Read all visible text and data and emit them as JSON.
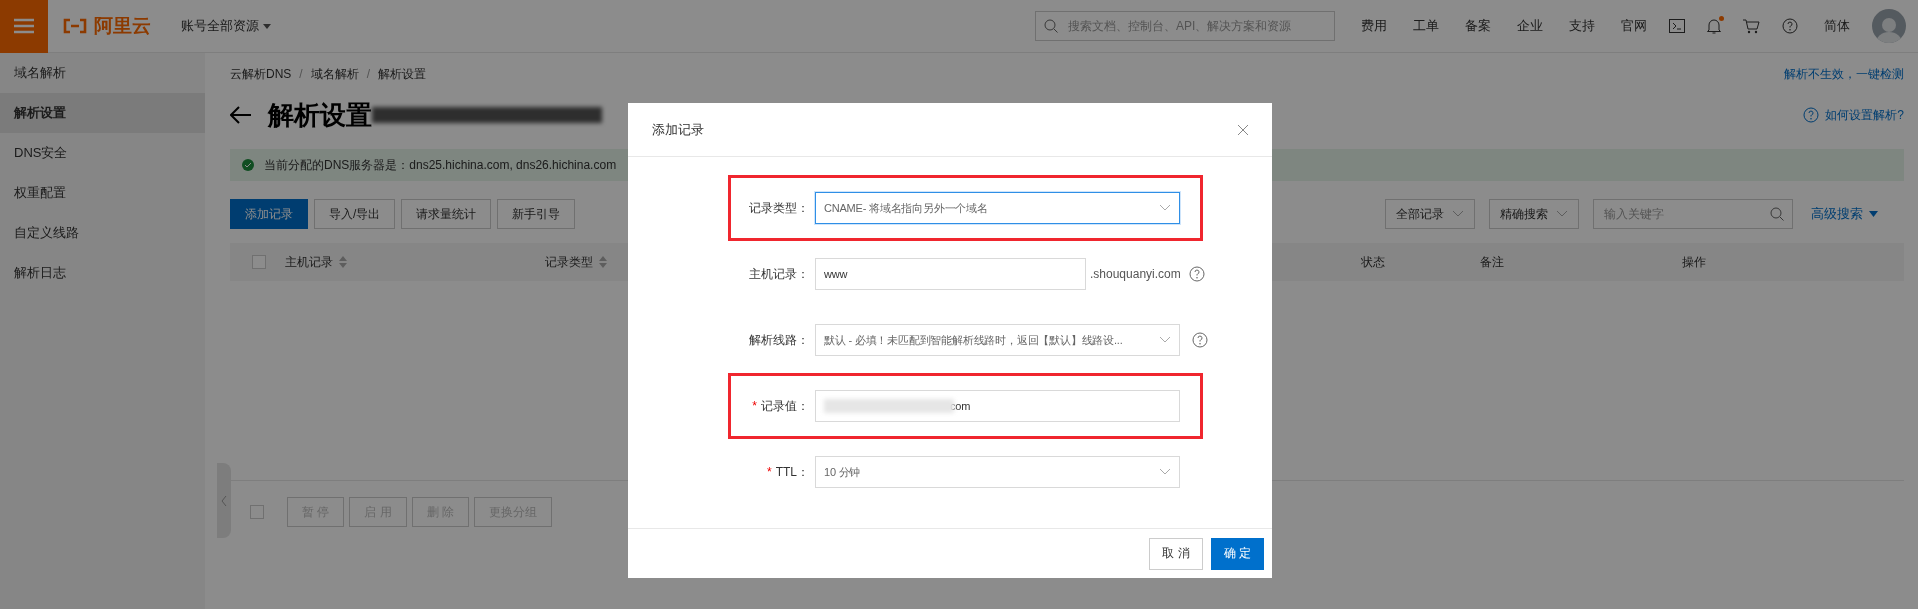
{
  "topbar": {
    "logo": "阿里云",
    "account_menu": "账号全部资源",
    "search": {
      "placeholder": "搜索文档、控制台、API、解决方案和资源"
    },
    "nav_links": [
      "费用",
      "工单",
      "备案",
      "企业",
      "支持",
      "官网"
    ],
    "bell_dot": true,
    "language": "简体"
  },
  "sidebar": {
    "title": "域名解析",
    "items": [
      {
        "label": "解析设置",
        "selected": true
      },
      {
        "label": "DNS安全",
        "selected": false
      },
      {
        "label": "权重配置",
        "selected": false
      },
      {
        "label": "自定义线路",
        "selected": false
      },
      {
        "label": "解析日志",
        "selected": false
      }
    ]
  },
  "breadcrumb": [
    "云解析DNS",
    "域名解析",
    "解析设置"
  ],
  "breadcrumb_separator": "/",
  "header_checkbox": {
    "checked": false
  },
  "bulk_checkbox": {
    "checked": false
  },
  "check_link": "解析不生效，一键检测",
  "page_title": "解析设置",
  "help_link": "如何设置解析?",
  "alert": "当前分配的DNS服务器是：dns25.hichina.com, dns26.hichina.com",
  "actions": [
    {
      "label": "添加记录",
      "primary": true
    },
    {
      "label": "导入/导出",
      "primary": false
    },
    {
      "label": "请求量统计",
      "primary": false
    },
    {
      "label": "新手引导",
      "primary": false
    }
  ],
  "filters": {
    "record_filter": "全部记录",
    "match_mode": "精确搜索",
    "search": {
      "placeholder": "输入关键字"
    },
    "advanced_search": "高级搜索"
  },
  "table": {
    "columns": [
      {
        "label": "主机记录",
        "sortable": true
      },
      {
        "label": "记录类型",
        "sortable": true
      },
      {
        "label": "状态",
        "sortable": false
      },
      {
        "label": "备注",
        "sortable": false
      },
      {
        "label": "操作",
        "sortable": false
      }
    ]
  },
  "bulk_actions": [
    {
      "label": "暂 停",
      "disabled": true
    },
    {
      "label": "启 用",
      "disabled": true
    },
    {
      "label": "删 除",
      "disabled": true
    },
    {
      "label": "更换分组",
      "disabled": true
    }
  ],
  "dialog": {
    "title": "添加记录",
    "required_mark": "*",
    "fields": [
      {
        "kind": "select",
        "label": "记录类型：",
        "required": false,
        "value": "CNAME- 将域名指向另外一个域名",
        "focused": true,
        "highlighted": true
      },
      {
        "kind": "input",
        "label": "主机记录：",
        "required": false,
        "value": "www",
        "suffix": ".shouquanyi.com",
        "help": true,
        "focused": false,
        "highlighted": false
      },
      {
        "kind": "select",
        "label": "解析线路：",
        "required": false,
        "value": "默认 - 必填！未匹配到智能解析线路时，返回【默认】线路设...",
        "help": true,
        "focused": false,
        "highlighted": false
      },
      {
        "kind": "input",
        "label": "记录值：",
        "required": true,
        "redacted": true,
        "value": "com",
        "focused": false,
        "highlighted": true
      },
      {
        "kind": "select",
        "label": "TTL：",
        "required": true,
        "value": "10 分钟",
        "focused": false,
        "highlighted": false
      }
    ],
    "buttons": [
      {
        "label": "取 消",
        "primary": false
      },
      {
        "label": "确 定",
        "primary": true
      }
    ]
  }
}
